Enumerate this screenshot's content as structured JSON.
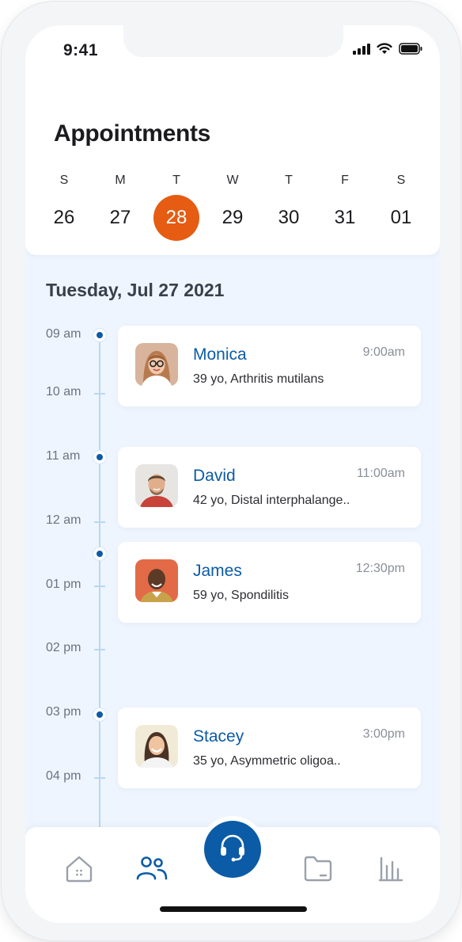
{
  "status_bar": {
    "time": "9:41",
    "icons": [
      "signal-icon",
      "wifi-icon",
      "battery-icon"
    ]
  },
  "header": {
    "title": "Appointments"
  },
  "week": {
    "days": [
      {
        "letter": "S",
        "number": "26"
      },
      {
        "letter": "M",
        "number": "27"
      },
      {
        "letter": "T",
        "number": "28",
        "selected": true
      },
      {
        "letter": "W",
        "number": "29"
      },
      {
        "letter": "T",
        "number": "30"
      },
      {
        "letter": "F",
        "number": "31"
      },
      {
        "letter": "S",
        "number": "01"
      }
    ]
  },
  "schedule": {
    "date_heading": "Tuesday, Jul 27 2021",
    "time_slots": [
      "09 am",
      "10 am",
      "11 am",
      "12 am",
      "01 pm",
      "02 pm",
      "03 pm",
      "04 pm"
    ]
  },
  "appointments": [
    {
      "name": "Monica",
      "info": "39 yo, Arthritis mutilans",
      "time": "9:00am"
    },
    {
      "name": "David",
      "info": "42 yo, Distal interphalange..",
      "time": "11:00am"
    },
    {
      "name": "James",
      "info": "59 yo, Spondilitis",
      "time": "12:30pm"
    },
    {
      "name": "Stacey",
      "info": "35 yo, Asymmetric oligoa..",
      "time": "3:00pm"
    }
  ],
  "tab_bar": {
    "items": [
      "home-icon",
      "patients-icon",
      "support-headset-icon",
      "folder-icon",
      "stats-icon"
    ],
    "active": "patients-icon"
  },
  "colors": {
    "accent": "#0c5ba7",
    "selected_day": "#e55c12",
    "background": "#eef5fe",
    "timeline": "#b9d6f3"
  }
}
